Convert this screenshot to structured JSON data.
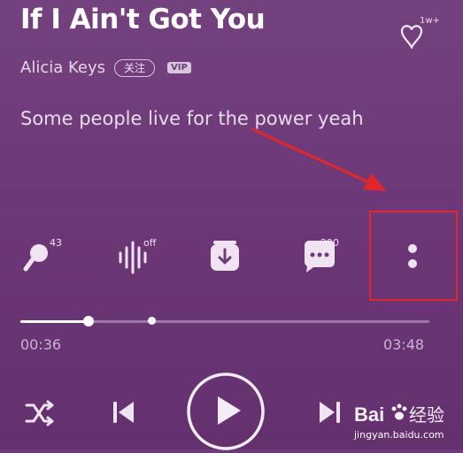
{
  "song": {
    "title": "If I Ain't Got You",
    "artist": "Alicia Keys",
    "follow_label": "关注",
    "vip_badge": "VIP",
    "favorite_count": "1w+"
  },
  "lyric": {
    "current_line": "Some people live for the power  yeah"
  },
  "actions": [
    {
      "name": "sing",
      "icon": "microphone-icon",
      "count": "43"
    },
    {
      "name": "sound-effect",
      "icon": "sound-wave-icon",
      "count": "off"
    },
    {
      "name": "download",
      "icon": "download-icon",
      "count": ""
    },
    {
      "name": "comments",
      "icon": "comment-icon",
      "count": "290"
    },
    {
      "name": "more",
      "icon": "more-vertical-icon",
      "count": ""
    }
  ],
  "playback": {
    "current_time": "00:36",
    "total_time": "03:48",
    "progress_fraction": 0.167,
    "marker_fraction": 0.32
  },
  "controls": {
    "shuffle": "shuffle-icon",
    "previous": "skip-previous-icon",
    "play": "play-icon",
    "next": "skip-next-icon"
  },
  "watermark": {
    "text": "Bai经验",
    "url": "jingyan.baidu.com"
  },
  "colors": {
    "background": "#6f3a7c",
    "highlight": "#e3262b",
    "arrow": "#e3262b"
  }
}
